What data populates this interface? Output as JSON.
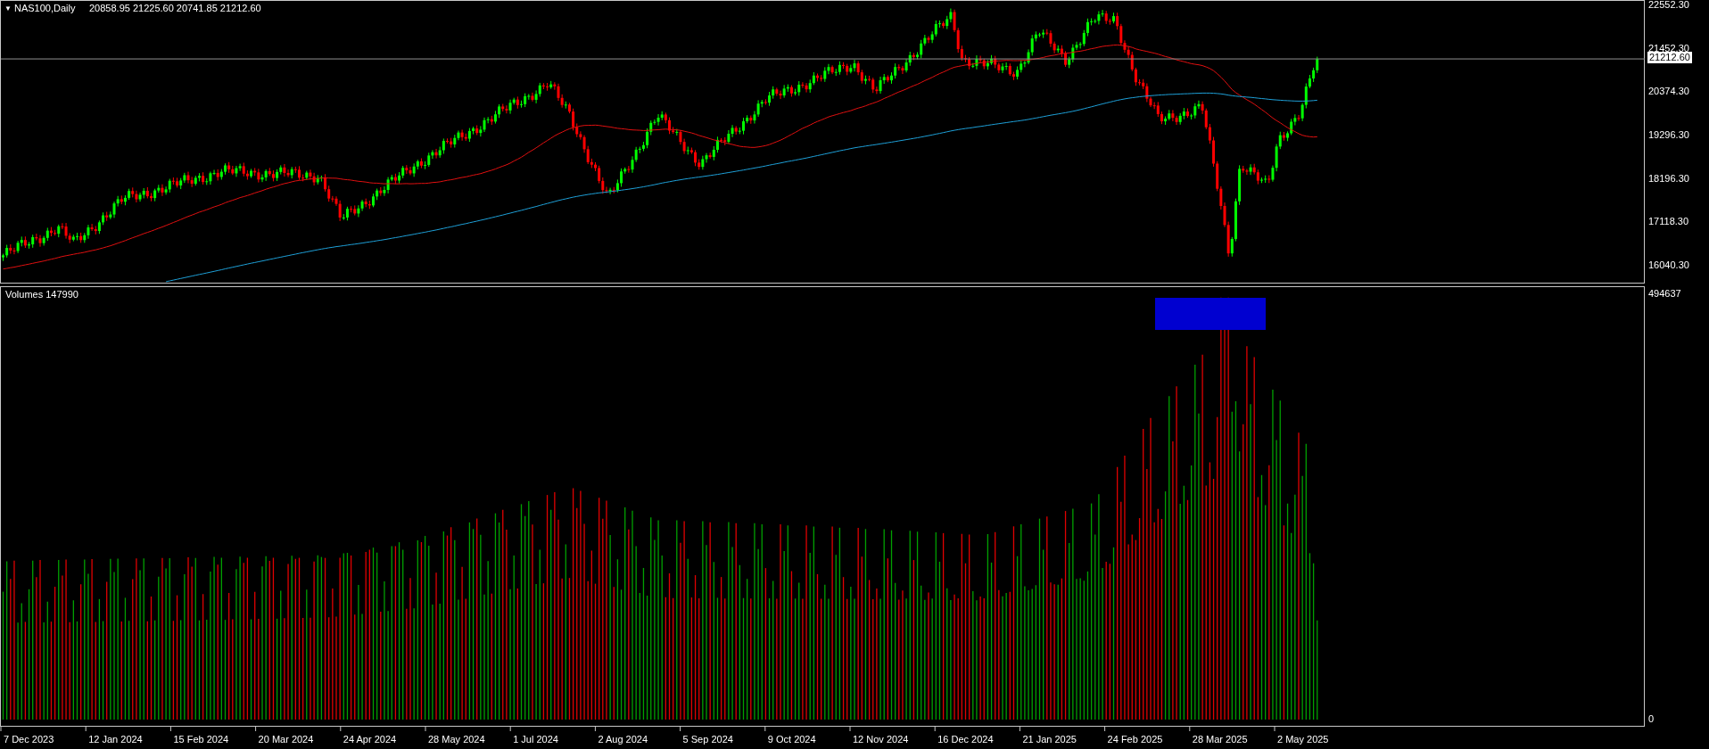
{
  "chart_header": {
    "menu_marker": "▼",
    "symbol": "NAS100,Daily",
    "ohlc": "20858.95 21225.60 20741.85 21212.60"
  },
  "price_axis": [
    "22552.30",
    "21452.30",
    "20374.30",
    "19296.30",
    "18196.30",
    "17118.30",
    "16040.30"
  ],
  "current_price": "21212.60",
  "volume_header": "Volumes 147990",
  "volume_axis": [
    "494637",
    "0"
  ],
  "date_axis": [
    "7 Dec 2023",
    "12 Jan 2024",
    "15 Feb 2024",
    "20 Mar 2024",
    "24 Apr 2024",
    "28 May 2024",
    "1 Jul 2024",
    "2 Aug 2024",
    "5 Sep 2024",
    "9 Oct 2024",
    "12 Nov 2024",
    "16 Dec 2024",
    "21 Jan 2025",
    "24 Feb 2025",
    "28 Mar 2025",
    "2 May 2025"
  ]
}
